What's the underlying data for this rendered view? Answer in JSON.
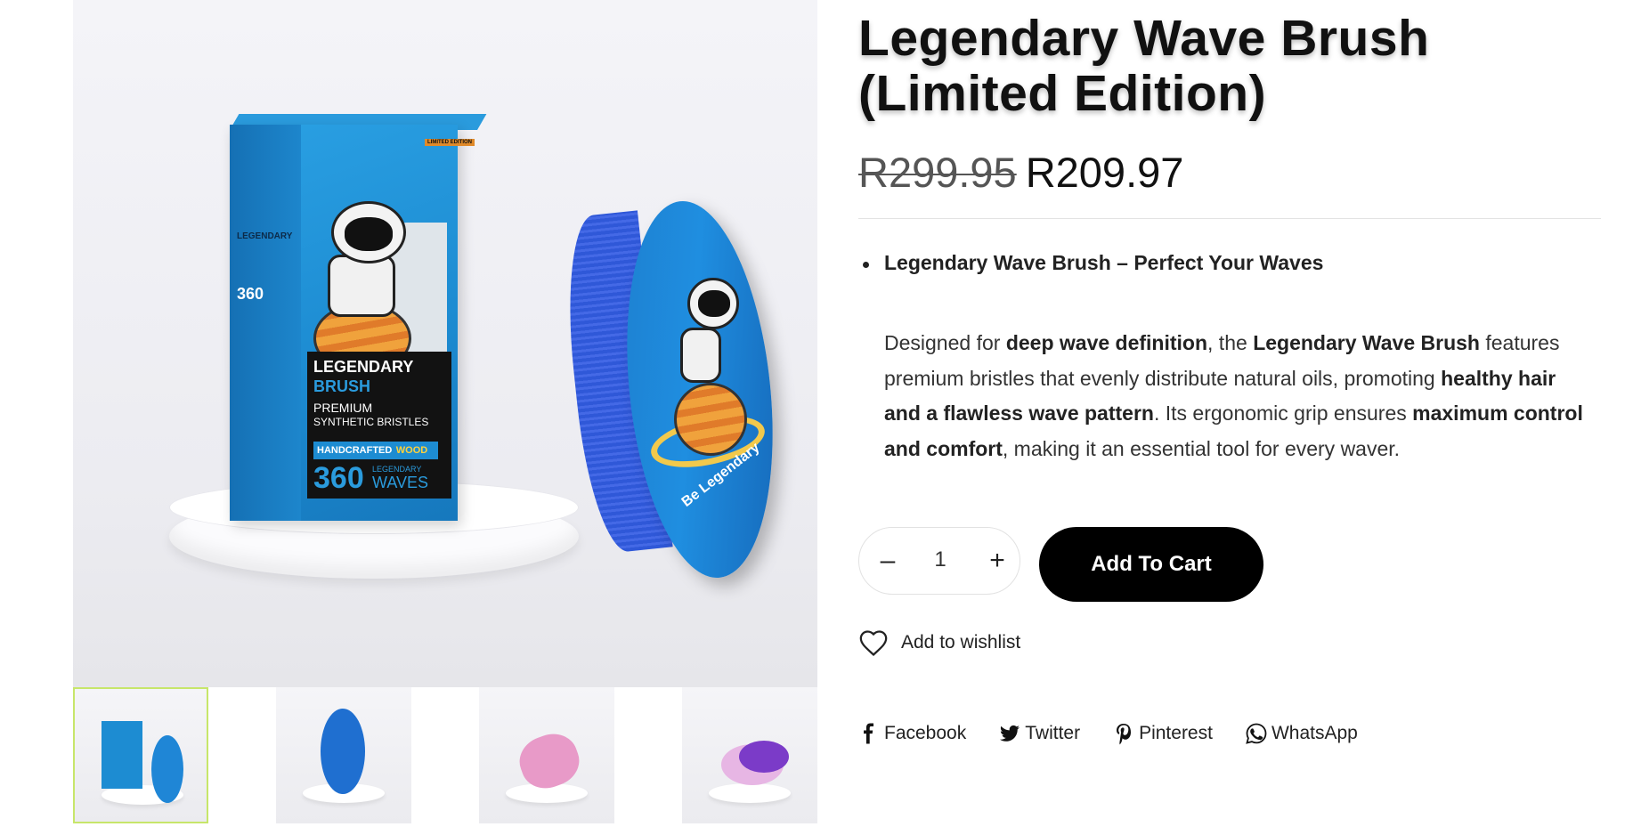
{
  "product": {
    "title": "Legendary Wave Brush (Limited Edition)",
    "price_old": "R299.95",
    "price_new": "R209.97",
    "bullet": "Legendary Wave Brush – Perfect Your Waves",
    "description": {
      "p1": "Designed for ",
      "b1": "deep wave definition",
      "p2": ", the ",
      "b2": "Legendary Wave Brush",
      "p3": " features premium bristles that evenly distribute natural oils, promoting ",
      "b3": "healthy hair and a flawless wave pattern",
      "p4": ". Its ergonomic grip ensures ",
      "b4": "maximum control and comfort",
      "p5": ", making it an essential tool for every waver."
    }
  },
  "image_text": {
    "limited_edition": "LIMITED EDITION",
    "legendary": "LEGENDARY",
    "brush": "BRUSH",
    "premium": "PREMIUM",
    "synthetic": "SYNTHETIC BRISTLES",
    "handcrafted": "HANDCRAFTED",
    "wood": "WOOD",
    "number": "360",
    "legendary_small": "LEGENDARY",
    "waves": "WAVES",
    "brush_caption": "Be Legendary"
  },
  "cart": {
    "quantity": "1",
    "minus_label": "–",
    "plus_label": "+",
    "add_to_cart": "Add To Cart"
  },
  "wishlist": {
    "label": "Add to wishlist",
    "icon": "heart-icon"
  },
  "share": [
    {
      "label": "Facebook",
      "icon": "facebook-icon"
    },
    {
      "label": "Twitter",
      "icon": "twitter-icon"
    },
    {
      "label": "Pinterest",
      "icon": "pinterest-icon"
    },
    {
      "label": "WhatsApp",
      "icon": "whatsapp-icon"
    }
  ],
  "colors": {
    "brand_blue": "#1f8ee0",
    "button_bg": "#000000",
    "thumb_active_border": "#c7e66a"
  }
}
